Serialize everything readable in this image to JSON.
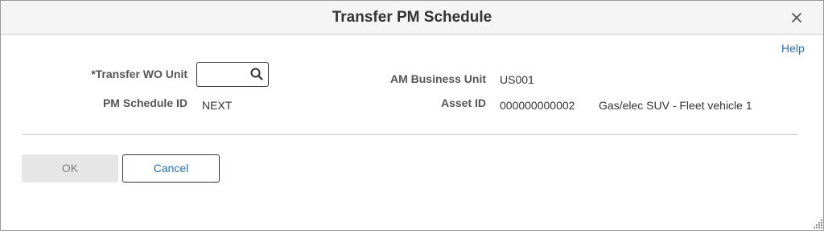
{
  "dialog": {
    "title": "Transfer PM Schedule",
    "close_icon": "close-icon",
    "help_label": "Help"
  },
  "form": {
    "transfer_wo_unit": {
      "label": "*Transfer WO Unit",
      "value": "",
      "icon": "search-icon"
    },
    "pm_schedule_id": {
      "label": "PM Schedule ID",
      "value": "NEXT"
    },
    "am_business_unit": {
      "label": "AM Business Unit",
      "value": "US001"
    },
    "asset_id": {
      "label": "Asset ID",
      "value": "000000000002",
      "description": "Gas/elec SUV - Fleet vehicle 1"
    }
  },
  "actions": {
    "ok_label": "OK",
    "cancel_label": "Cancel"
  },
  "colors": {
    "link": "#2a6ead",
    "title_bar_bg": "#f5f5f5",
    "disabled_button_bg": "#e6e6e6"
  }
}
